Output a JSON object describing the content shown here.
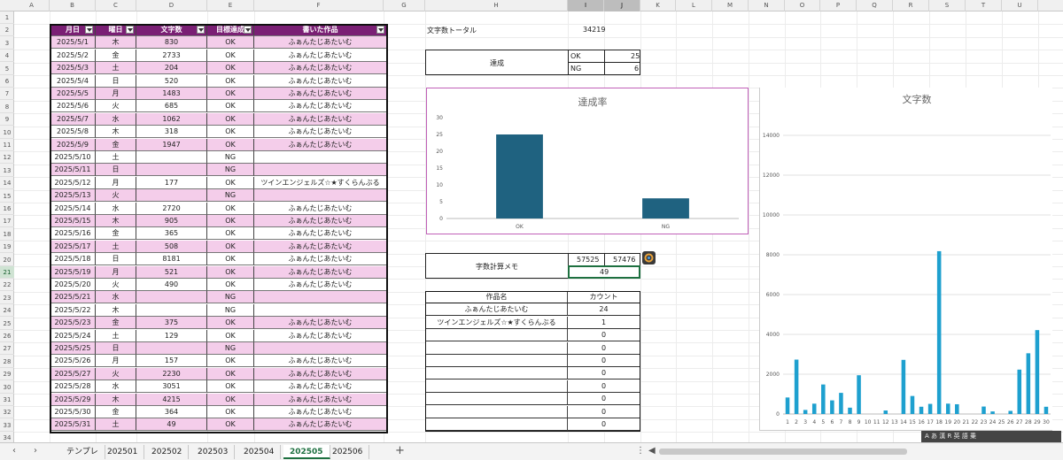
{
  "columns": [
    "A",
    "B",
    "C",
    "D",
    "E",
    "F",
    "G",
    "H",
    "I",
    "J",
    "K",
    "L",
    "M",
    "N",
    "O",
    "P",
    "Q",
    "R",
    "S",
    "T",
    "U"
  ],
  "selected_columns": [
    "I",
    "J"
  ],
  "selected_row": "21",
  "rows": [
    "1",
    "2",
    "3",
    "4",
    "5",
    "6",
    "7",
    "8",
    "9",
    "10",
    "11",
    "12",
    "13",
    "14",
    "15",
    "16",
    "17",
    "18",
    "19",
    "20",
    "21",
    "22",
    "23",
    "24",
    "25",
    "26",
    "27",
    "28",
    "29",
    "30",
    "31",
    "32",
    "33",
    "34"
  ],
  "log_table": {
    "headers": [
      "月日",
      "曜日",
      "文字数",
      "目標達成",
      "書いた作品"
    ],
    "rows": [
      [
        "2025/5/1",
        "木",
        "830",
        "OK",
        "ふぁんたじあたいむ"
      ],
      [
        "2025/5/2",
        "金",
        "2733",
        "OK",
        "ふぁんたじあたいむ"
      ],
      [
        "2025/5/3",
        "土",
        "204",
        "OK",
        "ふぁんたじあたいむ"
      ],
      [
        "2025/5/4",
        "日",
        "520",
        "OK",
        "ふぁんたじあたいむ"
      ],
      [
        "2025/5/5",
        "月",
        "1483",
        "OK",
        "ふぁんたじあたいむ"
      ],
      [
        "2025/5/6",
        "火",
        "685",
        "OK",
        "ふぁんたじあたいむ"
      ],
      [
        "2025/5/7",
        "水",
        "1062",
        "OK",
        "ふぁんたじあたいむ"
      ],
      [
        "2025/5/8",
        "木",
        "318",
        "OK",
        "ふぁんたじあたいむ"
      ],
      [
        "2025/5/9",
        "金",
        "1947",
        "OK",
        "ふぁんたじあたいむ"
      ],
      [
        "2025/5/10",
        "土",
        "",
        "NG",
        ""
      ],
      [
        "2025/5/11",
        "日",
        "",
        "NG",
        ""
      ],
      [
        "2025/5/12",
        "月",
        "177",
        "OK",
        "ツインエンジェルズ☆★すくらんぶる"
      ],
      [
        "2025/5/13",
        "火",
        "",
        "NG",
        ""
      ],
      [
        "2025/5/14",
        "水",
        "2720",
        "OK",
        "ふぁんたじあたいむ"
      ],
      [
        "2025/5/15",
        "木",
        "905",
        "OK",
        "ふぁんたじあたいむ"
      ],
      [
        "2025/5/16",
        "金",
        "365",
        "OK",
        "ふぁんたじあたいむ"
      ],
      [
        "2025/5/17",
        "土",
        "508",
        "OK",
        "ふぁんたじあたいむ"
      ],
      [
        "2025/5/18",
        "日",
        "8181",
        "OK",
        "ふぁんたじあたいむ"
      ],
      [
        "2025/5/19",
        "月",
        "521",
        "OK",
        "ふぁんたじあたいむ"
      ],
      [
        "2025/5/20",
        "火",
        "490",
        "OK",
        "ふぁんたじあたいむ"
      ],
      [
        "2025/5/21",
        "水",
        "",
        "NG",
        ""
      ],
      [
        "2025/5/22",
        "木",
        "",
        "NG",
        ""
      ],
      [
        "2025/5/23",
        "金",
        "375",
        "OK",
        "ふぁんたじあたいむ"
      ],
      [
        "2025/5/24",
        "土",
        "129",
        "OK",
        "ふぁんたじあたいむ"
      ],
      [
        "2025/5/25",
        "日",
        "",
        "NG",
        ""
      ],
      [
        "2025/5/26",
        "月",
        "157",
        "OK",
        "ふぁんたじあたいむ"
      ],
      [
        "2025/5/27",
        "火",
        "2230",
        "OK",
        "ふぁんたじあたいむ"
      ],
      [
        "2025/5/28",
        "水",
        "3051",
        "OK",
        "ふぁんたじあたいむ"
      ],
      [
        "2025/5/29",
        "木",
        "4215",
        "OK",
        "ふぁんたじあたいむ"
      ],
      [
        "2025/5/30",
        "金",
        "364",
        "OK",
        "ふぁんたじあたいむ"
      ],
      [
        "2025/5/31",
        "土",
        "49",
        "OK",
        "ふぁんたじあたいむ"
      ]
    ]
  },
  "total": {
    "label": "文字数トータル",
    "value": "34219"
  },
  "achievement": {
    "label": "達成",
    "ok_label": "OK",
    "ok_value": "25",
    "ng_label": "NG",
    "ng_value": "6"
  },
  "calc_memo": {
    "label": "字数計算メモ",
    "a": "57525",
    "b": "57476",
    "diff": "49"
  },
  "works_table": {
    "headers": [
      "作品名",
      "カウント"
    ],
    "rows": [
      [
        "ふぁんたじあたいむ",
        "24"
      ],
      [
        "ツインエンジェルズ☆★すくらんぶる",
        "1"
      ],
      [
        "",
        "0"
      ],
      [
        "",
        "0"
      ],
      [
        "",
        "0"
      ],
      [
        "",
        "0"
      ],
      [
        "",
        "0"
      ],
      [
        "",
        "0"
      ],
      [
        "",
        "0"
      ],
      [
        "",
        "0"
      ]
    ]
  },
  "sheet_tabs": [
    "テンプレ",
    "202501",
    "202502",
    "202503",
    "202504",
    "202505",
    "202506"
  ],
  "active_tab": "202505",
  "ime_bar": "A あ 漢 R 英 語 乗",
  "colors": {
    "header": "#7a1f74",
    "row_alt": "#f4cdea",
    "bar_dark": "#1f6280",
    "bar_light": "#1ea0cf",
    "chart_border": "#c060b8",
    "accent": "#1e7040"
  },
  "chart_data": [
    {
      "type": "bar",
      "title": "達成率",
      "categories": [
        "OK",
        "NG"
      ],
      "values": [
        25,
        6
      ],
      "ylim": [
        0,
        30
      ],
      "yticks": [
        0,
        5,
        10,
        15,
        20,
        25,
        30
      ],
      "grid": false,
      "legend": "none"
    },
    {
      "type": "bar",
      "title": "文字数",
      "categories": [
        "1",
        "2",
        "3",
        "4",
        "5",
        "6",
        "7",
        "8",
        "9",
        "10",
        "11",
        "12",
        "13",
        "14",
        "15",
        "16",
        "17",
        "18",
        "19",
        "20",
        "21",
        "22",
        "23",
        "24",
        "25",
        "26",
        "27",
        "28",
        "29",
        "30"
      ],
      "values": [
        830,
        2733,
        204,
        520,
        1483,
        685,
        1062,
        318,
        1947,
        0,
        0,
        177,
        0,
        2720,
        905,
        365,
        508,
        8181,
        521,
        490,
        0,
        0,
        375,
        129,
        0,
        157,
        2230,
        3051,
        4215,
        364
      ],
      "ylim": [
        0,
        14000
      ],
      "yticks": [
        0,
        2000,
        4000,
        6000,
        8000,
        10000,
        12000,
        14000
      ],
      "grid": true,
      "legend": "none"
    }
  ]
}
